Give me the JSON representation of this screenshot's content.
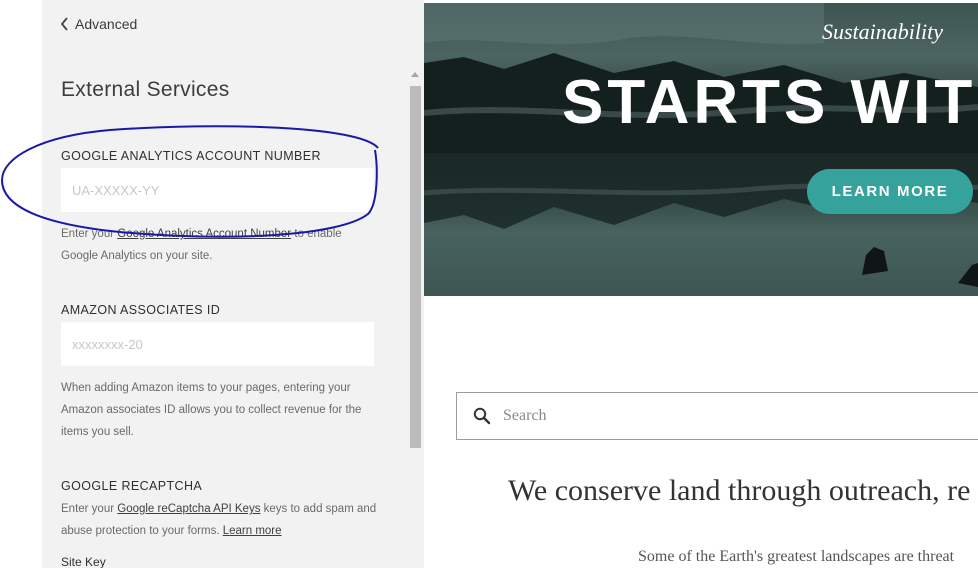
{
  "sidebar": {
    "back_label": "Advanced",
    "title": "External Services",
    "google_analytics": {
      "label": "GOOGLE ANALYTICS ACCOUNT NUMBER",
      "placeholder": "UA-XXXXX-YY",
      "value": "",
      "help_prefix": "Enter your ",
      "help_link": "Google Analytics Account Number",
      "help_suffix": " to enable Google Analytics on your site."
    },
    "amazon": {
      "label": "AMAZON ASSOCIATES ID",
      "placeholder": "xxxxxxxx-20",
      "value": "",
      "help": "When adding Amazon items to your pages, entering your Amazon associates ID allows you to collect revenue for the items you sell."
    },
    "recaptcha": {
      "label": "GOOGLE RECAPTCHA",
      "help_prefix": "Enter your ",
      "help_link": "Google reCaptcha API Keys",
      "help_middle": " keys to add spam and abuse protection to your forms. ",
      "help_link2": "Learn more",
      "site_key_label": "Site Key"
    }
  },
  "preview": {
    "kicker": "Sustainability",
    "title": "STARTS WITH",
    "button": "LEARN MORE",
    "search_placeholder": "Search",
    "heading": "We conserve land through outreach, re",
    "body": "Some of the Earth's greatest landscapes are threat"
  },
  "colors": {
    "panel_bg": "#f2f2f2",
    "accent_button": "#35a29c",
    "annotation_ink": "#1a1aa8"
  }
}
